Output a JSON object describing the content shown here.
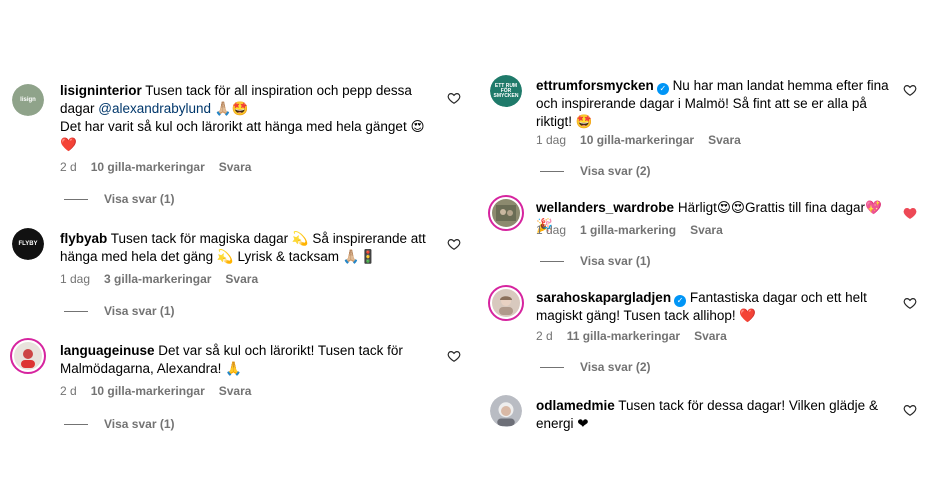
{
  "colors": {
    "liked_heart": "#ed4956",
    "meta_grey": "#737373",
    "mention": "#00376b",
    "verified": "#0095f6"
  },
  "left": [
    {
      "username": "lisigninterior",
      "avatar_icon": "lisigninterior-logo-avatar",
      "text_parts": [
        "Tusen tack för all inspiration och pepp dessa dagar ",
        "@alexandrabylund",
        " 🙏🏼🤩",
        "Det har varit så kul och lärorikt att hänga med hela gänget 😍❤️"
      ],
      "time": "2 d",
      "likes": "10 gilla-markeringar",
      "reply": "Svara",
      "view_replies": "Visa svar (1)",
      "liked": false
    },
    {
      "username": "flybyab",
      "avatar_icon": "flyby-logo-avatar",
      "text": "Tusen tack för magiska dagar 💫 Så inspirerande att hänga med hela det gäng 💫 Lyrisk & tacksam 🙏🏼🚦",
      "time": "1 dag",
      "likes": "3 gilla-markeringar",
      "reply": "Svara",
      "view_replies": "Visa svar (1)",
      "liked": false
    },
    {
      "username": "languageinuse",
      "avatar_icon": "languageinuse-photo-avatar",
      "text": "Det var så kul och lärorikt! Tusen tack för Malmödagarna, Alexandra! 🙏",
      "time": "2 d",
      "likes": "10 gilla-markeringar",
      "reply": "Svara",
      "view_replies": "Visa svar (1)",
      "liked": false
    }
  ],
  "right": [
    {
      "username": "ettrumforsmycken",
      "verified": true,
      "avatar_icon": "ettrumforsmycken-logo-avatar",
      "text": "Nu har man landat hemma efter fina och inspirerande dagar i Malmö! Så fint att se er alla på riktigt! 🤩",
      "time": "1 dag",
      "likes": "10 gilla-markeringar",
      "reply": "Svara",
      "view_replies": "Visa svar (2)",
      "liked": false
    },
    {
      "username": "wellanders_wardrobe",
      "avatar_icon": "wellanders-photo-avatar",
      "text": "Härligt😍😍Grattis till fina dagar💖🎉",
      "time": "1 dag",
      "likes": "1 gilla-markering",
      "reply": "Svara",
      "view_replies": "Visa svar (1)",
      "liked": true
    },
    {
      "username": "sarahoskapargladjen",
      "verified": true,
      "avatar_icon": "sarahoskapargladjen-photo-avatar",
      "text": "Fantastiska dagar och ett helt magiskt gäng! Tusen tack allihop! ❤️",
      "time": "2 d",
      "likes": "11 gilla-markeringar",
      "reply": "Svara",
      "view_replies": "Visa svar (2)",
      "liked": false
    },
    {
      "username": "odlamedmie",
      "avatar_icon": "odlamedmie-photo-avatar",
      "text": "Tusen tack för dessa dagar! Vilken glädje & energi ❤",
      "liked": false
    }
  ]
}
